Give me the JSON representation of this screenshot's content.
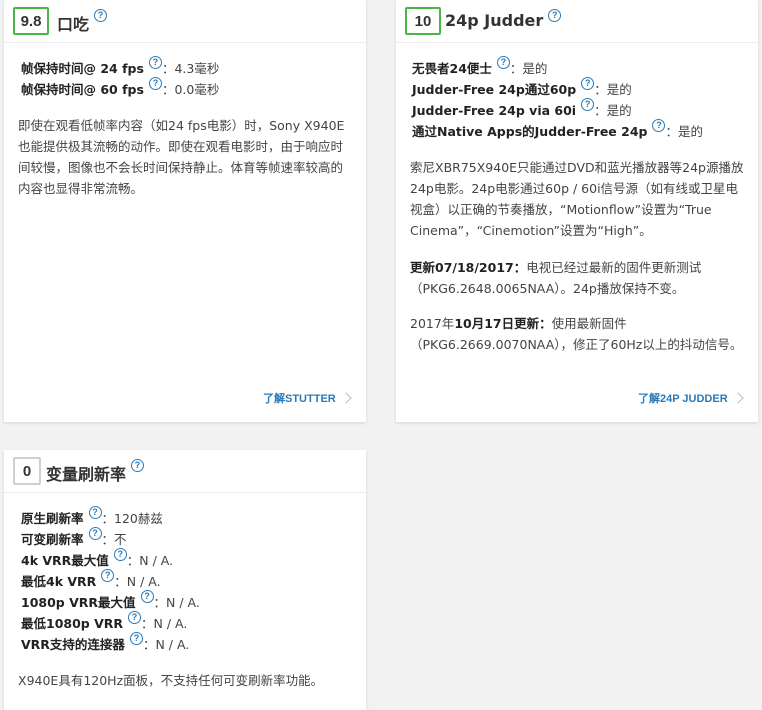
{
  "stutter": {
    "score": "9.8",
    "title": "口吃",
    "rows": [
      {
        "label": "帧保持时间@ 24 fps",
        "value": "：4.3毫秒"
      },
      {
        "label": "帧保持时间@ 60 fps",
        "value": "：0.0毫秒"
      }
    ],
    "paragraph": "即使在观看低帧率内容（如24 fps电影）时，Sony X940E也能提供极其流畅的动作。即使在观看电影时，由于响应时间较慢，图像也不会长时间保持静止。体育等帧速率较高的内容也显得非常流畅。",
    "link": "了解STUTTER"
  },
  "judder": {
    "score": "10",
    "title": "24p Judder",
    "rows": [
      {
        "label": "无畏者24便士",
        "value": "：是的"
      },
      {
        "label": "Judder-Free 24p通过60p",
        "value": "：是的"
      },
      {
        "label": "Judder-Free 24p via 60i",
        "value": "：是的"
      },
      {
        "label": "通过Native Apps的Judder-Free 24p",
        "value": "：是的"
      }
    ],
    "paragraph1": "索尼XBR75X940E只能通过DVD和蓝光播放器等24p源播放24p电影。24p电影通过60p / 60i信号源（如有线或卫星电视盒）以正确的节奏播放，“Motionflow”设置为“True Cinema”，“Cinemotion”设置为“High”。",
    "update1_bold": "更新07/18/2017：",
    "update1_text": "电视已经过最新的固件更新测试（PKG6.2648.0065NAA）。24p播放保持不变。",
    "update2_prefix": "2017年",
    "update2_bold": "10月17日更新：",
    "update2_text": "使用最新固件（PKG6.2669.0070NAA），修正了60Hz以上的抖动信号。",
    "link": "了解24P JUDDER"
  },
  "vrr": {
    "score": "0",
    "title": "变量刷新率",
    "rows": [
      {
        "label": "原生刷新率",
        "value": "：120赫兹"
      },
      {
        "label": "可变刷新率",
        "value": "：不"
      },
      {
        "label": "4k VRR最大值",
        "value": "：N / A."
      },
      {
        "label": "最低4k VRR",
        "value": "：N / A."
      },
      {
        "label": "1080p VRR最大值",
        "value": "：N / A."
      },
      {
        "label": "最低1080p VRR",
        "value": "：N / A."
      },
      {
        "label": "VRR支持的连接器",
        "value": "：N / A."
      }
    ],
    "paragraph": "X940E具有120Hz面板，不支持任何可变刷新率功能。"
  },
  "help_glyph": "?",
  "colors": {
    "score_good": "#49b649",
    "score_none": "#cfcfcf",
    "link": "#2a7ab8"
  }
}
